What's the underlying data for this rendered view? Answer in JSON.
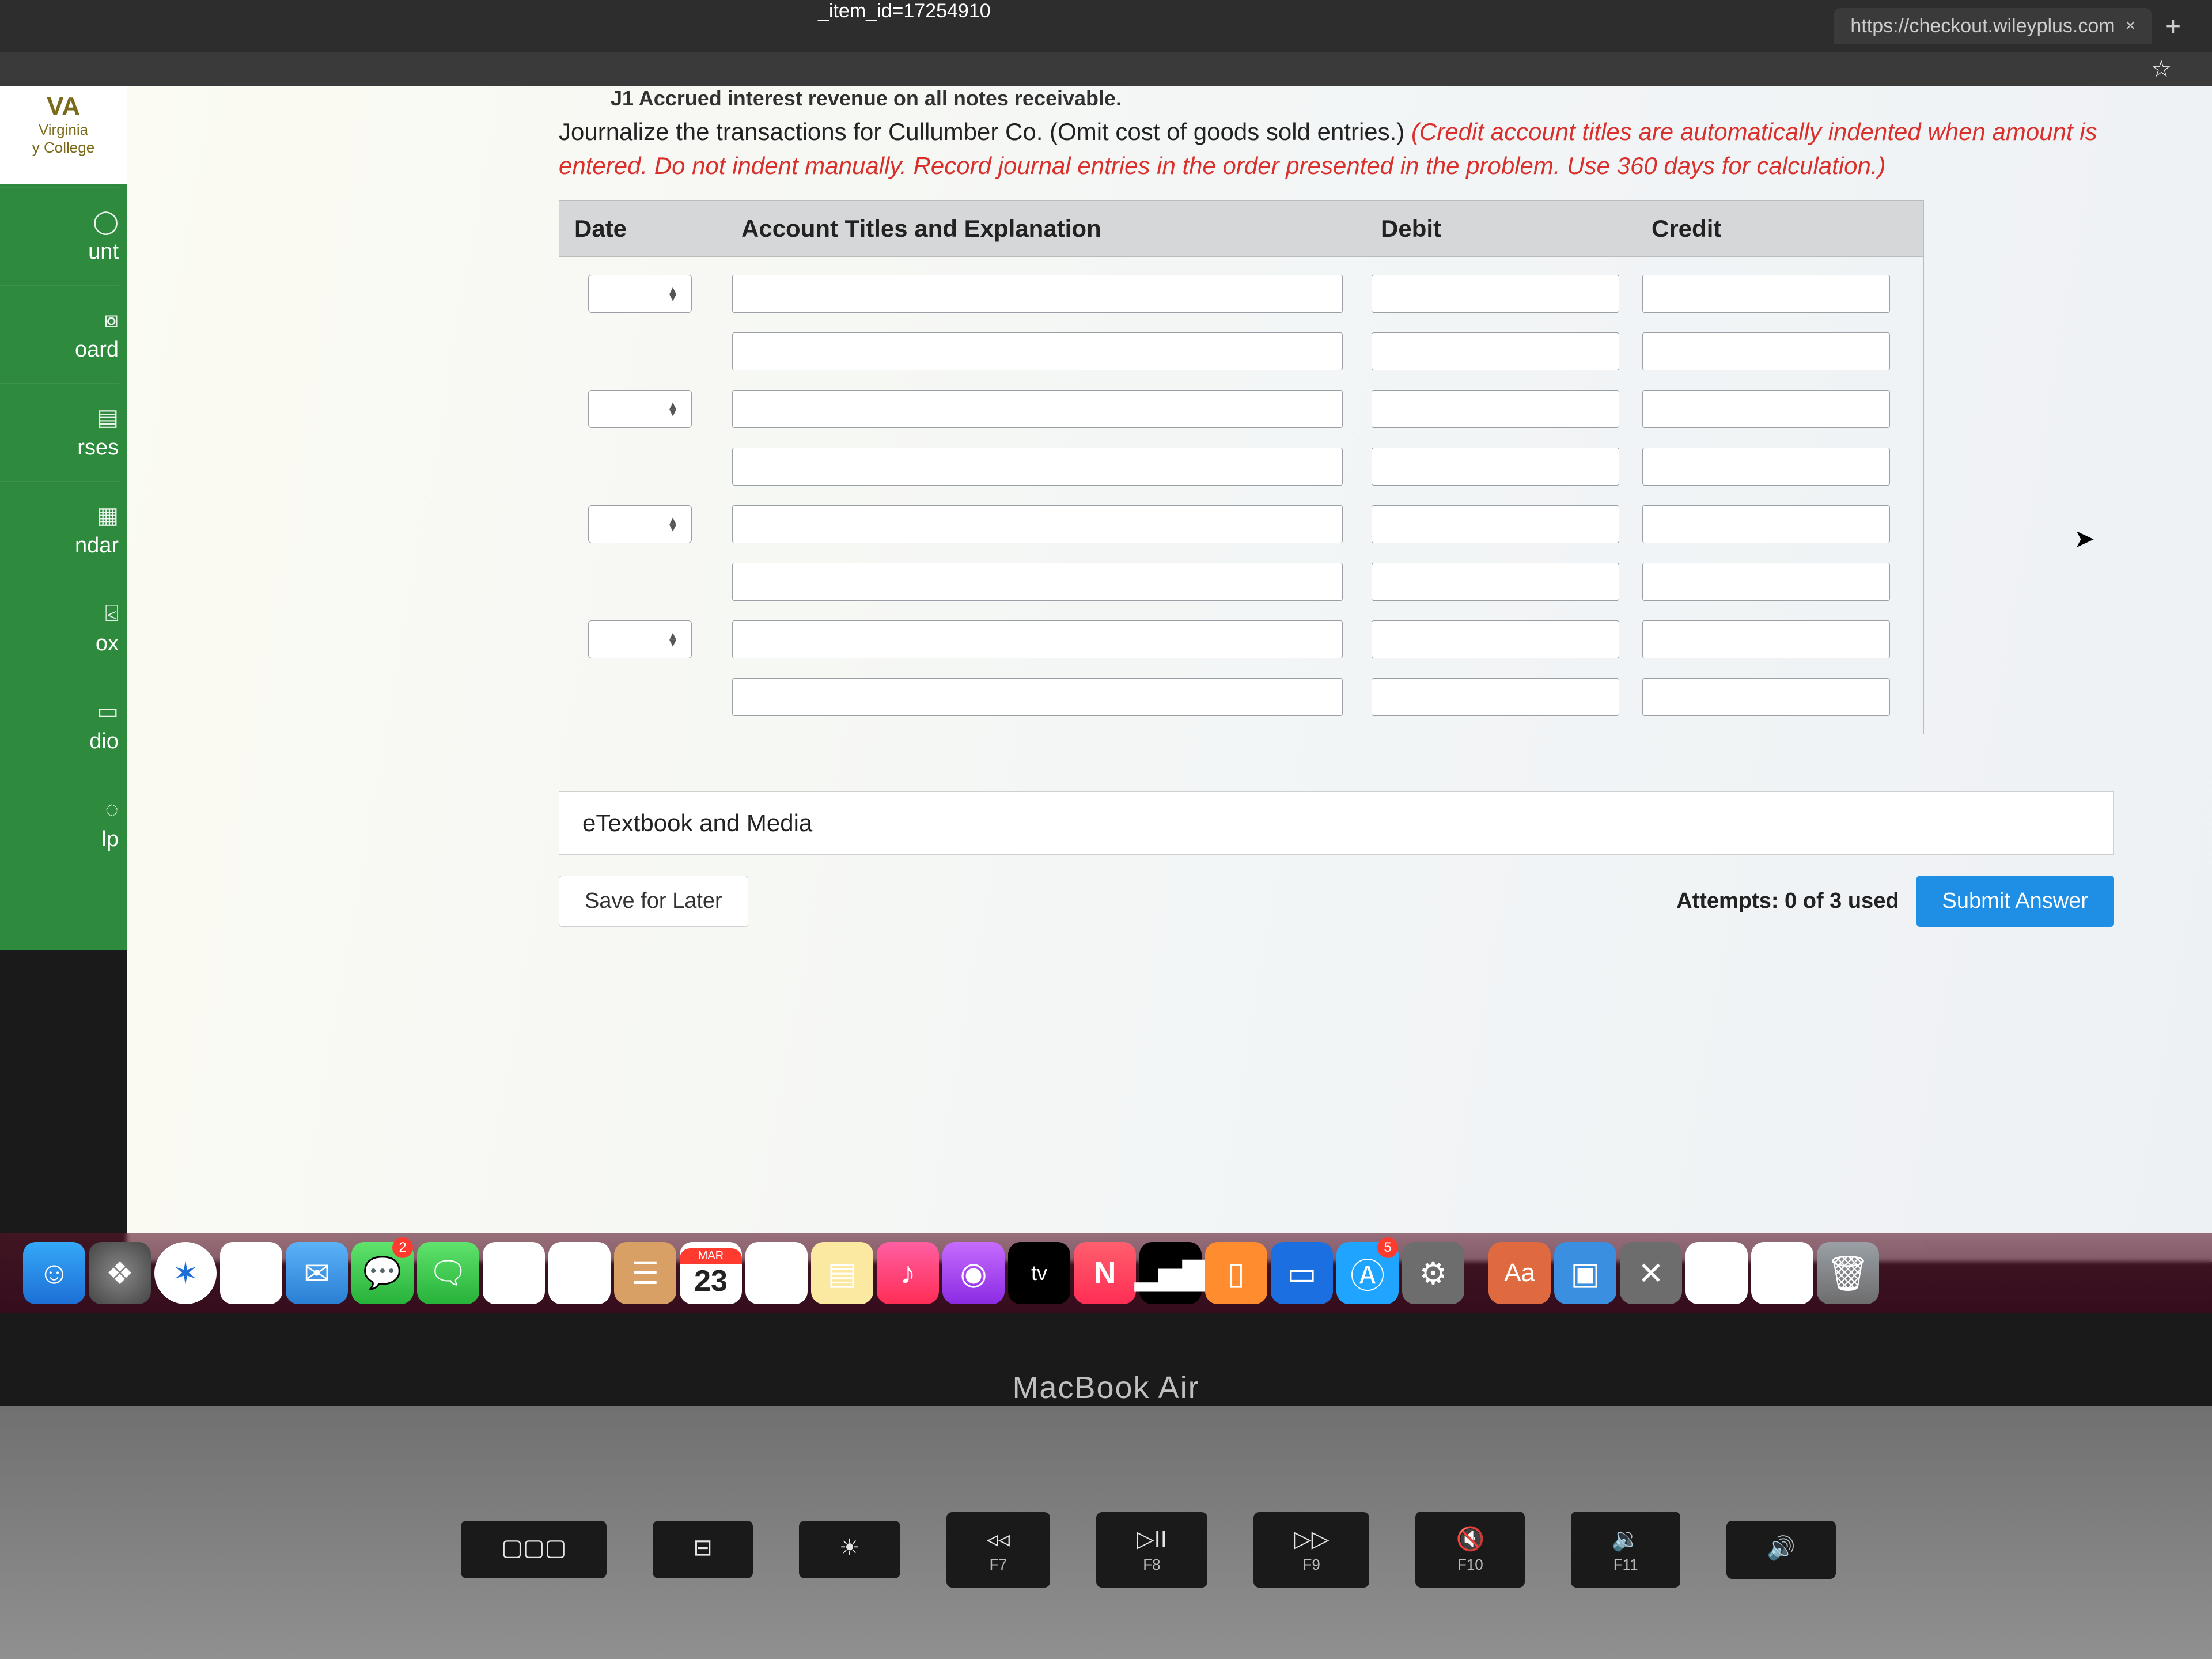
{
  "browser": {
    "address_fragment": "_item_id=17254910",
    "tab_url": "https://checkout.wileyplus.com",
    "tab_close": "×",
    "tab_plus": "+",
    "star": "☆"
  },
  "logo": {
    "top": "VA",
    "sub1": "Virginia",
    "sub2": "y College"
  },
  "sidebar": {
    "items": [
      {
        "label": "unt"
      },
      {
        "label": "oard"
      },
      {
        "label": "rses"
      },
      {
        "label": "ndar"
      },
      {
        "label": "ox"
      },
      {
        "label": "dio"
      },
      {
        "label": "lp"
      }
    ]
  },
  "content": {
    "breadcrumb_remnant": "J1     Accrued interest revenue on all notes receivable.",
    "instruction_plain": "Journalize the transactions for Cullumber Co. (Omit cost of goods sold entries.) ",
    "instruction_red": "(Credit account titles are automatically indented when amount is entered. Do not indent manually. Record journal entries in the order presented in the problem. Use 360 days for calculation.)",
    "headers": {
      "date": "Date",
      "acct": "Account Titles and Explanation",
      "debit": "Debit",
      "credit": "Credit"
    },
    "etext": "eTextbook and Media",
    "save": "Save for Later",
    "attempts": "Attempts: 0 of 3 used",
    "submit": "Submit Answer"
  },
  "dock": {
    "calendar_month": "MAR",
    "calendar_day": "23",
    "tv_label": "tv",
    "news_glyph": "N",
    "dict_glyph": "Aa",
    "badge_messages": "2",
    "badge_appstore": "5"
  },
  "laptop": {
    "model": "MacBook Air",
    "keys": [
      {
        "sym": "▢▢▢",
        "lbl": ""
      },
      {
        "sym": "⊟",
        "lbl": ""
      },
      {
        "sym": "☀",
        "lbl": ""
      },
      {
        "sym": "◃◃",
        "lbl": "F7"
      },
      {
        "sym": "▷II",
        "lbl": "F8"
      },
      {
        "sym": "▷▷",
        "lbl": "F9"
      },
      {
        "sym": "🔇",
        "lbl": "F10"
      },
      {
        "sym": "🔉",
        "lbl": "F11"
      },
      {
        "sym": "🔊",
        "lbl": ""
      }
    ]
  }
}
